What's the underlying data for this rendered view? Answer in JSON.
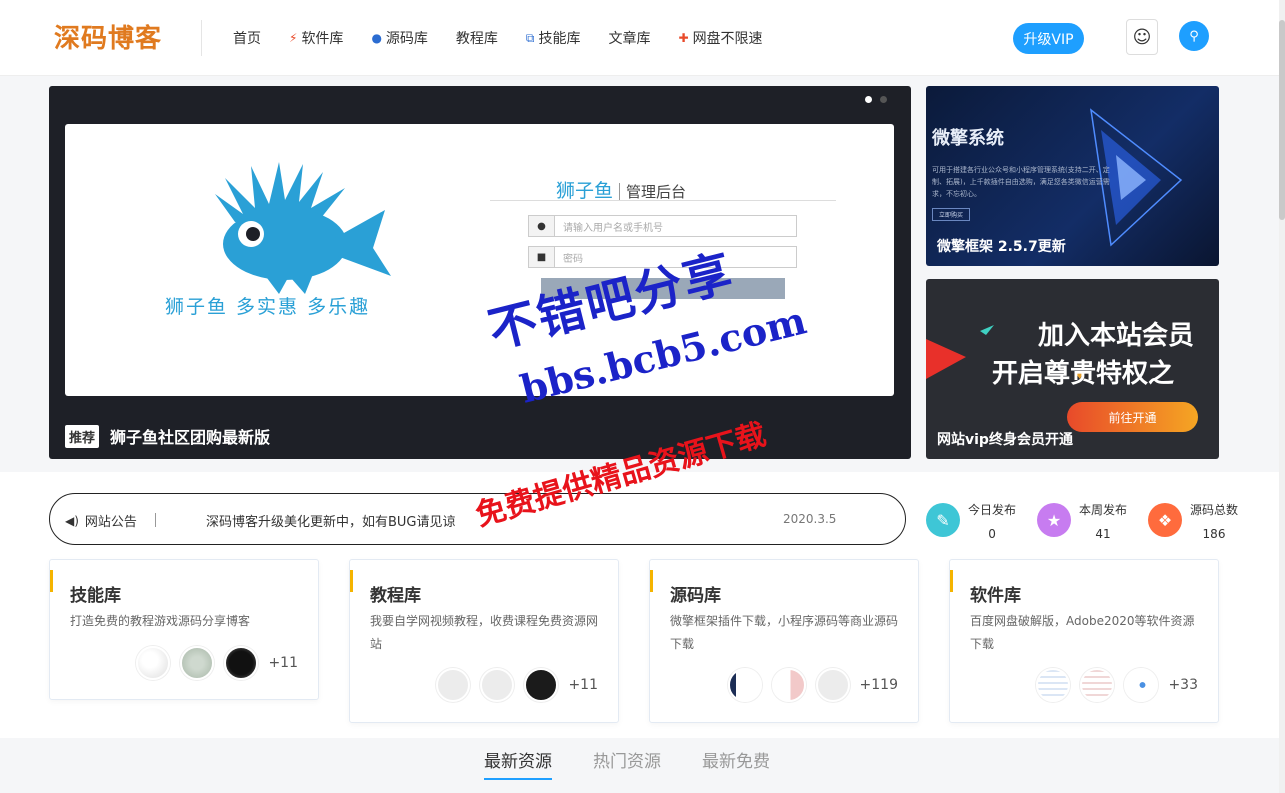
{
  "header": {
    "logo": "深码博客",
    "nav": [
      {
        "label": "首页",
        "icon": ""
      },
      {
        "label": "软件库",
        "icon": "bolt-icon"
      },
      {
        "label": "源码库",
        "icon": "globe-icon"
      },
      {
        "label": "教程库",
        "icon": ""
      },
      {
        "label": "技能库",
        "icon": "sitemap-icon"
      },
      {
        "label": "文章库",
        "icon": ""
      },
      {
        "label": "网盘不限速",
        "icon": "gamepad-icon"
      }
    ],
    "vip_label": "升级VIP"
  },
  "slider": {
    "tag": "推荐",
    "title": "狮子鱼社区团购最新版",
    "fish_slogan": "狮子鱼  多实惠  多乐趣",
    "login_brand": "狮子鱼",
    "login_sub": "管理后台",
    "username_placeholder": "请输入用户名或手机号",
    "password_placeholder": "密码"
  },
  "side_cards": [
    {
      "heading": "微擎系统",
      "desc": "可用于搭建各行业公众号和小程序管理系统(支持二开、定制、拓展)，上千款插件自由选购，满足您各类微信运营需求，不忘初心。",
      "btn": "立即购买",
      "title": "微擎框架 2.5.7更新"
    },
    {
      "line1": "加入本站会员",
      "line2": "开启尊贵特权之",
      "btn": "前往开通",
      "title": "网站vip终身会员开通"
    }
  ],
  "notice": {
    "label": "网站公告",
    "text": "深码博客升级美化更新中，如有BUG请见谅",
    "date": "2020.3.5"
  },
  "stats": [
    {
      "label": "今日发布",
      "value": "0",
      "color": "#3ec6d6"
    },
    {
      "label": "本周发布",
      "value": "41",
      "color": "#c77cf0"
    },
    {
      "label": "源码总数",
      "value": "186",
      "color": "#ff6b3d"
    }
  ],
  "categories": [
    {
      "title": "技能库",
      "desc": "打造免费的教程游戏源码分享博客",
      "more": "+11"
    },
    {
      "title": "教程库",
      "desc": "我要自学网视频教程，收费课程免费资源网站",
      "more": "+11"
    },
    {
      "title": "源码库",
      "desc": "微擎框架插件下载，小程序源码等商业源码下载",
      "more": "+119"
    },
    {
      "title": "软件库",
      "desc": "百度网盘破解版，Adobe2020等软件资源下载",
      "more": "+33"
    }
  ],
  "tabs": [
    "最新资源",
    "热门资源",
    "最新免费"
  ],
  "watermark": {
    "line1": "不错吧分享",
    "line2": "bbs.bcb5.com",
    "line3": "免费提供精品资源下载"
  },
  "colors": {
    "accent": "#1e9fff",
    "logo": "#e07a1f"
  }
}
